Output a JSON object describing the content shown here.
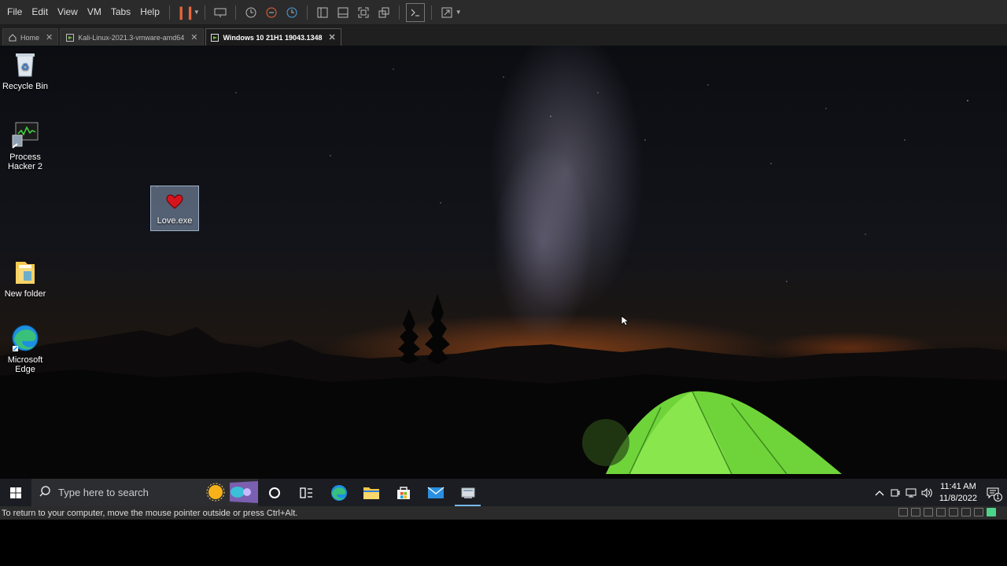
{
  "menubar": {
    "items": [
      "File",
      "Edit",
      "View",
      "VM",
      "Tabs",
      "Help"
    ]
  },
  "tabs": [
    {
      "label": "Home",
      "active": false
    },
    {
      "label": "Kali-Linux-2021.3-vmware-amd64",
      "active": false
    },
    {
      "label": "Windows 10 21H1 19043.1348",
      "active": true
    }
  ],
  "desktop": {
    "icons": [
      {
        "label": "Recycle Bin",
        "icon": "recycle-bin-icon"
      },
      {
        "label": "Process Hacker 2",
        "icon": "process-hacker-icon"
      },
      {
        "label": "Love.exe",
        "icon": "heart-icon"
      },
      {
        "label": "New folder",
        "icon": "folder-icon"
      },
      {
        "label": "Microsoft Edge",
        "icon": "edge-icon"
      }
    ]
  },
  "taskbar": {
    "search_placeholder": "Type here to search",
    "time": "11:41 AM",
    "date": "11/8/2022",
    "notification_count": "1"
  },
  "statusbar": {
    "message": "To return to your computer, move the mouse pointer outside or press Ctrl+Alt."
  },
  "colors": {
    "accent": "#76b9ed",
    "pause": "#e8663b",
    "tent": "#7ee03a"
  }
}
